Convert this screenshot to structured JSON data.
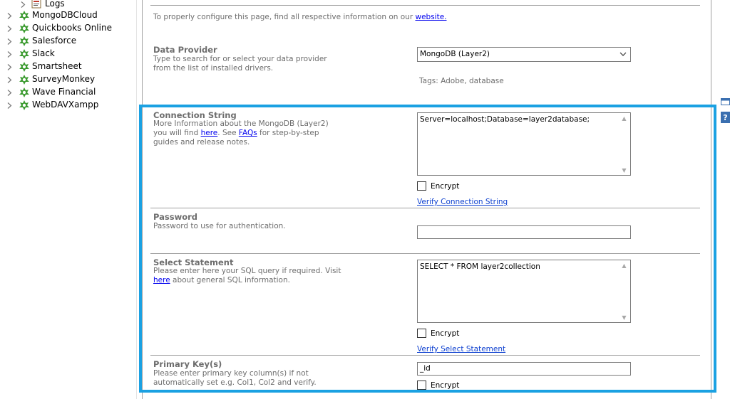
{
  "tree": {
    "items": [
      {
        "label": "Logs",
        "icon": "logs-icon"
      },
      {
        "label": "MongoDBCloud",
        "icon": "connector-icon"
      },
      {
        "label": "Quickbooks Online",
        "icon": "connector-icon"
      },
      {
        "label": "Salesforce",
        "icon": "connector-icon"
      },
      {
        "label": "Slack",
        "icon": "connector-icon"
      },
      {
        "label": "Smartsheet",
        "icon": "connector-icon"
      },
      {
        "label": "SurveyMonkey",
        "icon": "connector-icon"
      },
      {
        "label": "Wave Financial",
        "icon": "connector-icon"
      },
      {
        "label": "WebDAVXampp",
        "icon": "connector-icon"
      }
    ]
  },
  "intro": {
    "text": "To properly configure this page, find all respective information on our",
    "link": "website."
  },
  "data_provider": {
    "title": "Data Provider",
    "desc": "Type to search for or select your data provider from the list of installed drivers.",
    "selected": "MongoDB (Layer2)",
    "tags": "Tags: Adobe, database"
  },
  "connection_string": {
    "title": "Connection String",
    "desc1": "More Information about the MongoDB (Layer2) you will find",
    "here": "here",
    "desc2": ". See",
    "faqs": "FAQs",
    "desc3": "for step-by-step guides and release notes.",
    "value": "Server=localhost;Database=layer2database;",
    "encrypt_label": "Encrypt",
    "verify_label": "Verify Connection String"
  },
  "password": {
    "title": "Password",
    "desc": "Password to use for authentication.",
    "value": ""
  },
  "select_statement": {
    "title": "Select Statement",
    "desc1": "Please enter here your SQL query if required. Visit",
    "here": "here",
    "desc2": "about general SQL information.",
    "value": "SELECT * FROM layer2collection",
    "encrypt_label": "Encrypt",
    "verify_label": "Verify Select Statement"
  },
  "primary_key": {
    "title": "Primary Key(s)",
    "desc": "Please enter primary key column(s) if not automatically set e.g. Col1, Col2 and verify.",
    "value": "_id",
    "encrypt_label": "Encrypt"
  },
  "colors": {
    "highlight": "#1ba1e2",
    "link": "#0000ee",
    "connector_green": "#3a9a2e"
  }
}
